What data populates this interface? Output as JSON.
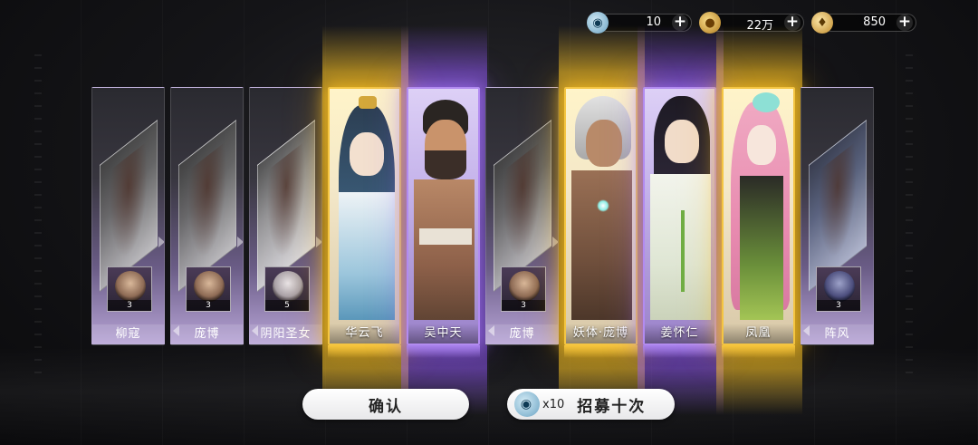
{
  "currencies": [
    {
      "icon": "fish-token-icon",
      "amount": "10"
    },
    {
      "icon": "coin-icon",
      "amount": "22万"
    },
    {
      "icon": "pin-token-icon",
      "amount": "850"
    }
  ],
  "cards": [
    {
      "name": "柳寇",
      "rarity": "common",
      "count": "3"
    },
    {
      "name": "庞博",
      "rarity": "common",
      "count": "3"
    },
    {
      "name": "阴阳圣女",
      "rarity": "common",
      "count": "5"
    },
    {
      "name": "华云飞",
      "rarity": "gold"
    },
    {
      "name": "吴中天",
      "rarity": "purple"
    },
    {
      "name": "庞博",
      "rarity": "common",
      "count": "3"
    },
    {
      "name": "妖体·庞博",
      "rarity": "gold"
    },
    {
      "name": "姜怀仁",
      "rarity": "purple"
    },
    {
      "name": "凤凰",
      "rarity": "gold"
    },
    {
      "name": "阵风",
      "rarity": "common",
      "count": "3"
    }
  ],
  "buttons": {
    "confirm": "确认",
    "recruit_multiplier": "x10",
    "recruit": "招募十次"
  },
  "colors": {
    "gold_glow": "#f4c542",
    "purple_glow": "#b28bf0",
    "common_card": "#6a5c86"
  }
}
